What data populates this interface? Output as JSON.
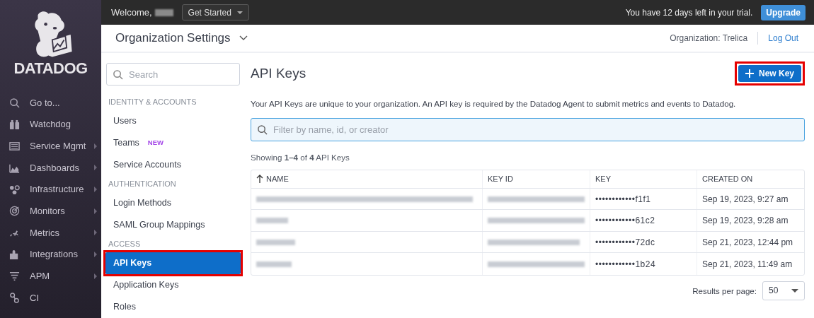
{
  "brand": {
    "name": "DATADOG"
  },
  "nav": [
    {
      "label": "Go to...",
      "has_submenu": false
    },
    {
      "label": "Watchdog",
      "has_submenu": false
    },
    {
      "label": "Service Mgmt",
      "has_submenu": true
    },
    {
      "label": "Dashboards",
      "has_submenu": true
    },
    {
      "label": "Infrastructure",
      "has_submenu": true
    },
    {
      "label": "Monitors",
      "has_submenu": true
    },
    {
      "label": "Metrics",
      "has_submenu": true
    },
    {
      "label": "Integrations",
      "has_submenu": true
    },
    {
      "label": "APM",
      "has_submenu": true
    },
    {
      "label": "CI",
      "has_submenu": false
    }
  ],
  "top_bar": {
    "welcome": "Welcome,",
    "get_started": "Get Started",
    "trial": "You have 12 days left in your trial.",
    "upgrade": "Upgrade"
  },
  "header": {
    "title": "Organization Settings",
    "organization": "Organization: Trelica",
    "logout": "Log Out"
  },
  "settings_menu": {
    "search_placeholder": "Search",
    "sections": [
      {
        "title": "IDENTITY & ACCOUNTS",
        "items": [
          {
            "label": "Users",
            "selected": false
          },
          {
            "label": "Teams",
            "badge": "NEW",
            "selected": false
          },
          {
            "label": "Service Accounts",
            "selected": false
          }
        ]
      },
      {
        "title": "AUTHENTICATION",
        "items": [
          {
            "label": "Login Methods",
            "selected": false
          },
          {
            "label": "SAML Group Mappings",
            "selected": false
          }
        ]
      },
      {
        "title": "ACCESS",
        "items": [
          {
            "label": "API Keys",
            "selected": true,
            "highlighted": true
          },
          {
            "label": "Application Keys",
            "selected": false
          },
          {
            "label": "Roles",
            "selected": false
          }
        ]
      }
    ]
  },
  "main": {
    "title": "API Keys",
    "new_key": {
      "label": "New Key",
      "highlighted": true
    },
    "description": "Your API Keys are unique to your organization. An API key is required by the Datadog Agent to submit metrics and events to Datadog.",
    "filter_placeholder": "Filter by name, id, or creator",
    "showing": "Showing **1–4** of **4** API Keys",
    "table": {
      "columns": [
        "NAME",
        "KEY ID",
        "KEY",
        "CREATED ON"
      ],
      "rows": [
        {
          "key": "••••••••••••f1f1",
          "created_on": "Sep 19, 2023, 9:27 am"
        },
        {
          "key": "••••••••••••61c2",
          "created_on": "Sep 19, 2023, 9:28 am"
        },
        {
          "key": "••••••••••••72dc",
          "created_on": "Sep 21, 2023, 12:44 pm"
        },
        {
          "key": "••••••••••••1b24",
          "created_on": "Sep 21, 2023, 11:49 am"
        }
      ]
    },
    "results_per_page": {
      "label": "Results per page:",
      "value": "50"
    }
  }
}
